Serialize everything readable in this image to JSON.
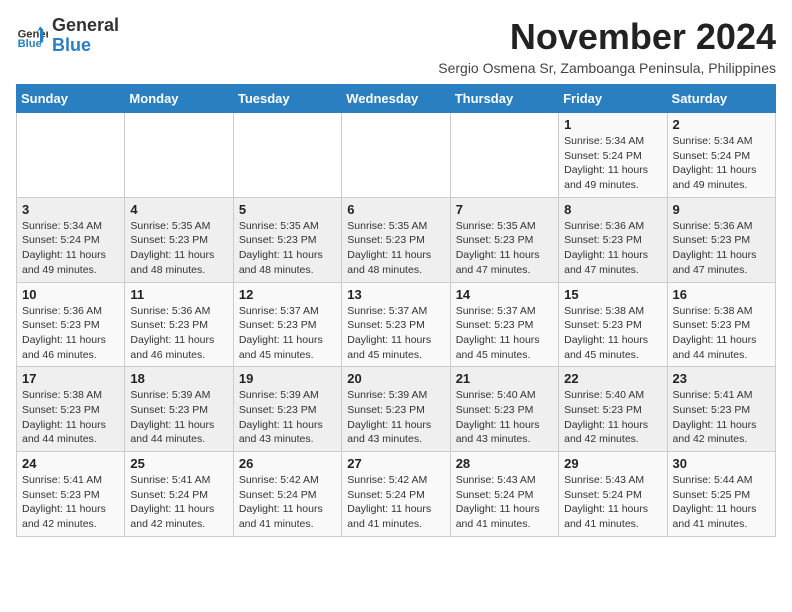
{
  "logo": {
    "line1": "General",
    "line2": "Blue"
  },
  "title": "November 2024",
  "subtitle": "Sergio Osmena Sr, Zamboanga Peninsula, Philippines",
  "weekdays": [
    "Sunday",
    "Monday",
    "Tuesday",
    "Wednesday",
    "Thursday",
    "Friday",
    "Saturday"
  ],
  "weeks": [
    [
      {
        "day": "",
        "info": ""
      },
      {
        "day": "",
        "info": ""
      },
      {
        "day": "",
        "info": ""
      },
      {
        "day": "",
        "info": ""
      },
      {
        "day": "",
        "info": ""
      },
      {
        "day": "1",
        "info": "Sunrise: 5:34 AM\nSunset: 5:24 PM\nDaylight: 11 hours and 49 minutes."
      },
      {
        "day": "2",
        "info": "Sunrise: 5:34 AM\nSunset: 5:24 PM\nDaylight: 11 hours and 49 minutes."
      }
    ],
    [
      {
        "day": "3",
        "info": "Sunrise: 5:34 AM\nSunset: 5:24 PM\nDaylight: 11 hours and 49 minutes."
      },
      {
        "day": "4",
        "info": "Sunrise: 5:35 AM\nSunset: 5:23 PM\nDaylight: 11 hours and 48 minutes."
      },
      {
        "day": "5",
        "info": "Sunrise: 5:35 AM\nSunset: 5:23 PM\nDaylight: 11 hours and 48 minutes."
      },
      {
        "day": "6",
        "info": "Sunrise: 5:35 AM\nSunset: 5:23 PM\nDaylight: 11 hours and 48 minutes."
      },
      {
        "day": "7",
        "info": "Sunrise: 5:35 AM\nSunset: 5:23 PM\nDaylight: 11 hours and 47 minutes."
      },
      {
        "day": "8",
        "info": "Sunrise: 5:36 AM\nSunset: 5:23 PM\nDaylight: 11 hours and 47 minutes."
      },
      {
        "day": "9",
        "info": "Sunrise: 5:36 AM\nSunset: 5:23 PM\nDaylight: 11 hours and 47 minutes."
      }
    ],
    [
      {
        "day": "10",
        "info": "Sunrise: 5:36 AM\nSunset: 5:23 PM\nDaylight: 11 hours and 46 minutes."
      },
      {
        "day": "11",
        "info": "Sunrise: 5:36 AM\nSunset: 5:23 PM\nDaylight: 11 hours and 46 minutes."
      },
      {
        "day": "12",
        "info": "Sunrise: 5:37 AM\nSunset: 5:23 PM\nDaylight: 11 hours and 45 minutes."
      },
      {
        "day": "13",
        "info": "Sunrise: 5:37 AM\nSunset: 5:23 PM\nDaylight: 11 hours and 45 minutes."
      },
      {
        "day": "14",
        "info": "Sunrise: 5:37 AM\nSunset: 5:23 PM\nDaylight: 11 hours and 45 minutes."
      },
      {
        "day": "15",
        "info": "Sunrise: 5:38 AM\nSunset: 5:23 PM\nDaylight: 11 hours and 45 minutes."
      },
      {
        "day": "16",
        "info": "Sunrise: 5:38 AM\nSunset: 5:23 PM\nDaylight: 11 hours and 44 minutes."
      }
    ],
    [
      {
        "day": "17",
        "info": "Sunrise: 5:38 AM\nSunset: 5:23 PM\nDaylight: 11 hours and 44 minutes."
      },
      {
        "day": "18",
        "info": "Sunrise: 5:39 AM\nSunset: 5:23 PM\nDaylight: 11 hours and 44 minutes."
      },
      {
        "day": "19",
        "info": "Sunrise: 5:39 AM\nSunset: 5:23 PM\nDaylight: 11 hours and 43 minutes."
      },
      {
        "day": "20",
        "info": "Sunrise: 5:39 AM\nSunset: 5:23 PM\nDaylight: 11 hours and 43 minutes."
      },
      {
        "day": "21",
        "info": "Sunrise: 5:40 AM\nSunset: 5:23 PM\nDaylight: 11 hours and 43 minutes."
      },
      {
        "day": "22",
        "info": "Sunrise: 5:40 AM\nSunset: 5:23 PM\nDaylight: 11 hours and 42 minutes."
      },
      {
        "day": "23",
        "info": "Sunrise: 5:41 AM\nSunset: 5:23 PM\nDaylight: 11 hours and 42 minutes."
      }
    ],
    [
      {
        "day": "24",
        "info": "Sunrise: 5:41 AM\nSunset: 5:23 PM\nDaylight: 11 hours and 42 minutes."
      },
      {
        "day": "25",
        "info": "Sunrise: 5:41 AM\nSunset: 5:24 PM\nDaylight: 11 hours and 42 minutes."
      },
      {
        "day": "26",
        "info": "Sunrise: 5:42 AM\nSunset: 5:24 PM\nDaylight: 11 hours and 41 minutes."
      },
      {
        "day": "27",
        "info": "Sunrise: 5:42 AM\nSunset: 5:24 PM\nDaylight: 11 hours and 41 minutes."
      },
      {
        "day": "28",
        "info": "Sunrise: 5:43 AM\nSunset: 5:24 PM\nDaylight: 11 hours and 41 minutes."
      },
      {
        "day": "29",
        "info": "Sunrise: 5:43 AM\nSunset: 5:24 PM\nDaylight: 11 hours and 41 minutes."
      },
      {
        "day": "30",
        "info": "Sunrise: 5:44 AM\nSunset: 5:25 PM\nDaylight: 11 hours and 41 minutes."
      }
    ]
  ]
}
